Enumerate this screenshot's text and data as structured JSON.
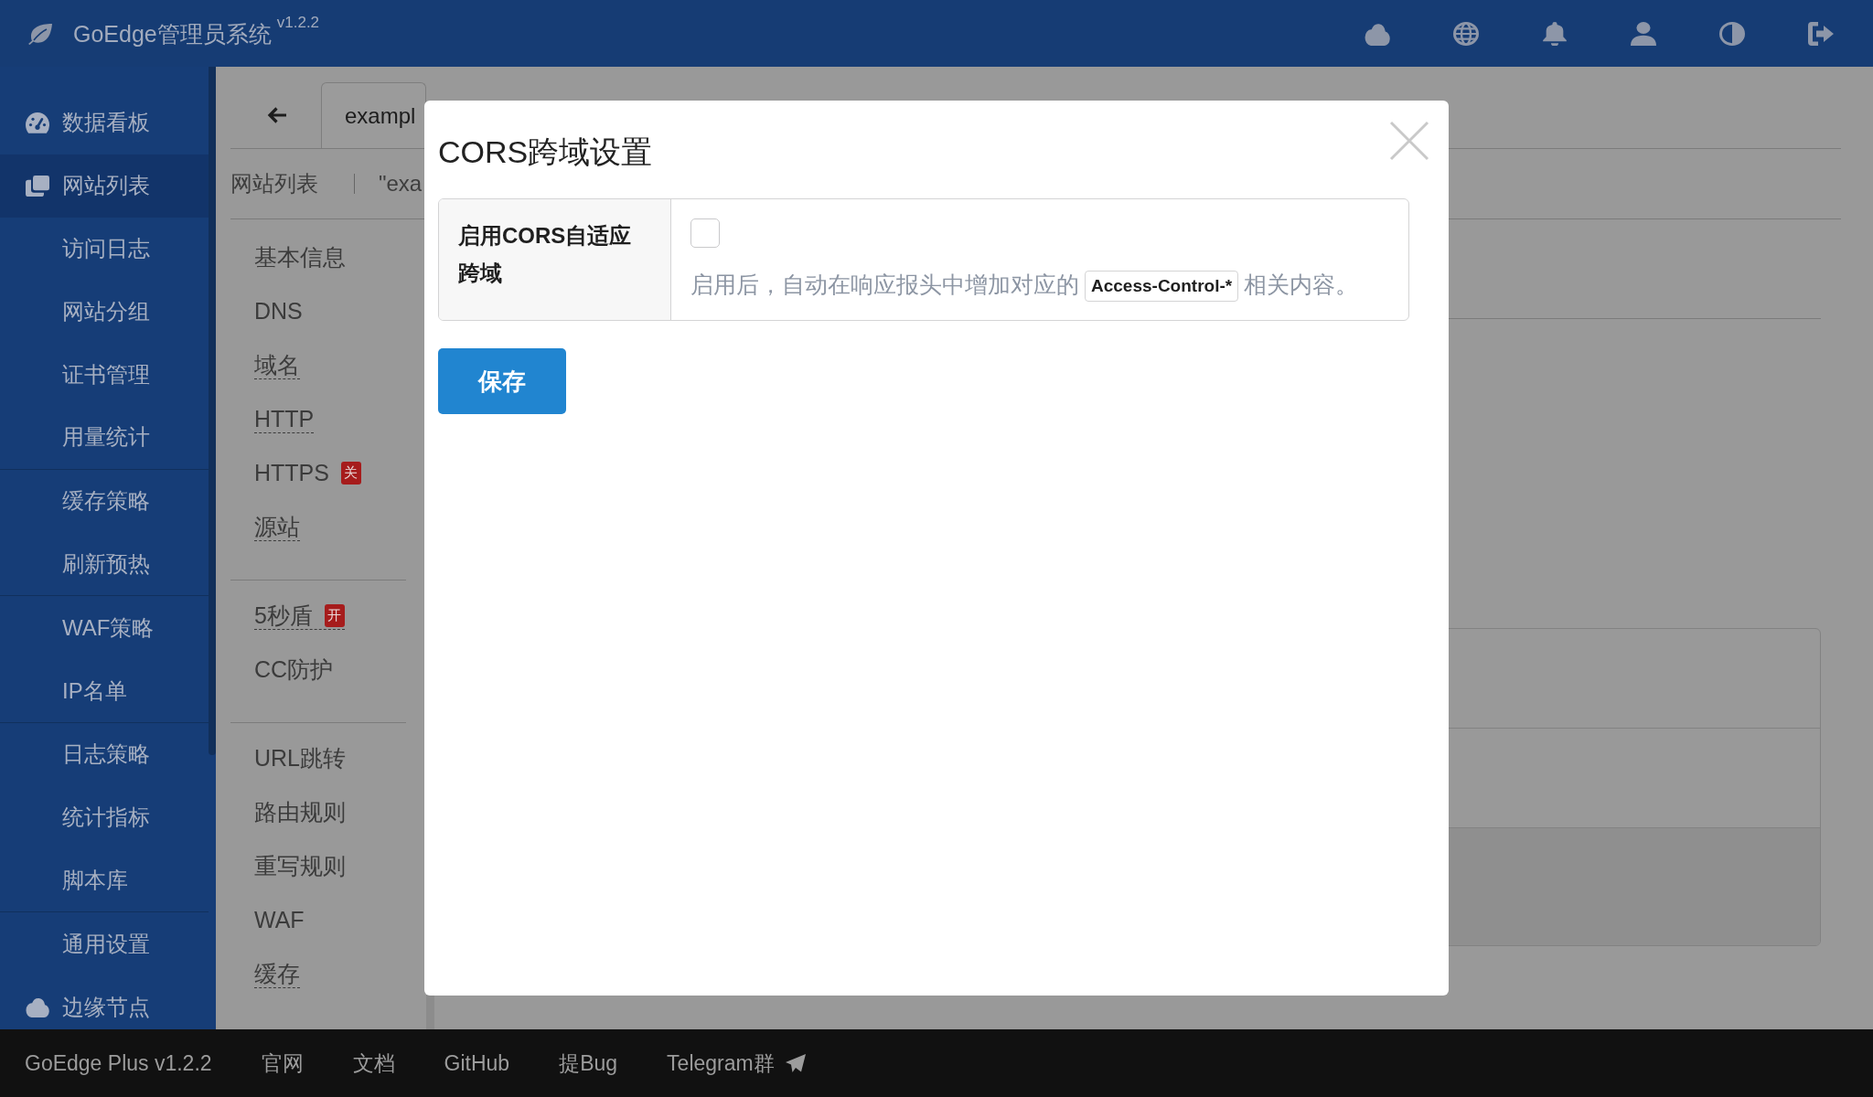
{
  "topbar": {
    "title": "GoEdge管理员系统",
    "version": "v1.2.2"
  },
  "sidebar": {
    "items": [
      {
        "label": "数据看板",
        "selected": false
      },
      {
        "label": "网站列表",
        "selected": true,
        "groups": [
          {
            "items": [
              {
                "label": "访问日志",
                "selected": false
              },
              {
                "label": "网站分组",
                "selected": false
              },
              {
                "label": "证书管理",
                "selected": false
              },
              {
                "label": "用量统计",
                "selected": false
              }
            ]
          },
          {
            "items": [
              {
                "label": "缓存策略",
                "selected": false
              },
              {
                "label": "刷新预热",
                "selected": false
              }
            ]
          },
          {
            "items": [
              {
                "label": "WAF策略",
                "selected": false
              },
              {
                "label": "IP名单",
                "selected": false
              }
            ]
          },
          {
            "items": [
              {
                "label": "日志策略",
                "selected": false
              },
              {
                "label": "统计指标",
                "selected": false
              },
              {
                "label": "脚本库",
                "selected": false
              }
            ]
          },
          {
            "items": [
              {
                "label": "通用设置",
                "selected": false
              }
            ]
          }
        ]
      },
      {
        "label": "边缘节点",
        "selected": false
      }
    ]
  },
  "tabs": [
    {
      "label": "exampl",
      "selected": true
    }
  ],
  "breadcrumb": [
    {
      "label": "网站列表"
    },
    {
      "label": "\"exa"
    }
  ],
  "settings_menu": {
    "groups": [
      {
        "items": [
          {
            "label": "基本信息",
            "selected": false,
            "underlined": false
          },
          {
            "label": "DNS",
            "selected": false,
            "underlined": false
          },
          {
            "label": "域名",
            "selected": false,
            "underlined": true
          },
          {
            "label": "HTTP",
            "selected": false,
            "underlined": true
          },
          {
            "label": "HTTPS",
            "selected": false,
            "underlined": false,
            "badge": "关"
          },
          {
            "label": "源站",
            "selected": false,
            "underlined": true
          }
        ]
      },
      {
        "items": [
          {
            "label": "5秒盾",
            "selected": false,
            "underlined": true,
            "badge": "开"
          },
          {
            "label": "CC防护",
            "selected": false,
            "underlined": false
          }
        ]
      },
      {
        "items": [
          {
            "label": "URL跳转",
            "selected": false,
            "underlined": false
          },
          {
            "label": "路由规则",
            "selected": false,
            "underlined": false
          },
          {
            "label": "重写规则",
            "selected": false,
            "underlined": false
          },
          {
            "label": "WAF",
            "selected": false,
            "underlined": false
          },
          {
            "label": "缓存",
            "selected": false,
            "underlined": true
          }
        ]
      }
    ]
  },
  "modal": {
    "title": "CORS跨域设置",
    "fields": [
      {
        "label": "启用CORS自适应跨域",
        "checked": false,
        "hint": {
          "before": "启用后，自动在响应报头中增加对应的",
          "code": "Access-Control-*",
          "after": "相关内容。"
        }
      }
    ],
    "buttons": [
      {
        "label": "保存"
      }
    ]
  },
  "footer": {
    "items": [
      {
        "label": "GoEdge Plus v1.2.2",
        "kind": "text",
        "has_icon": false
      },
      {
        "label": "官网",
        "kind": "link",
        "has_icon": false
      },
      {
        "label": "文档",
        "kind": "link",
        "has_icon": false
      },
      {
        "label": "GitHub",
        "kind": "link",
        "has_icon": false
      },
      {
        "label": "提Bug",
        "kind": "link",
        "has_icon": false
      },
      {
        "label": "Telegram群",
        "kind": "link",
        "has_icon": true
      }
    ]
  }
}
